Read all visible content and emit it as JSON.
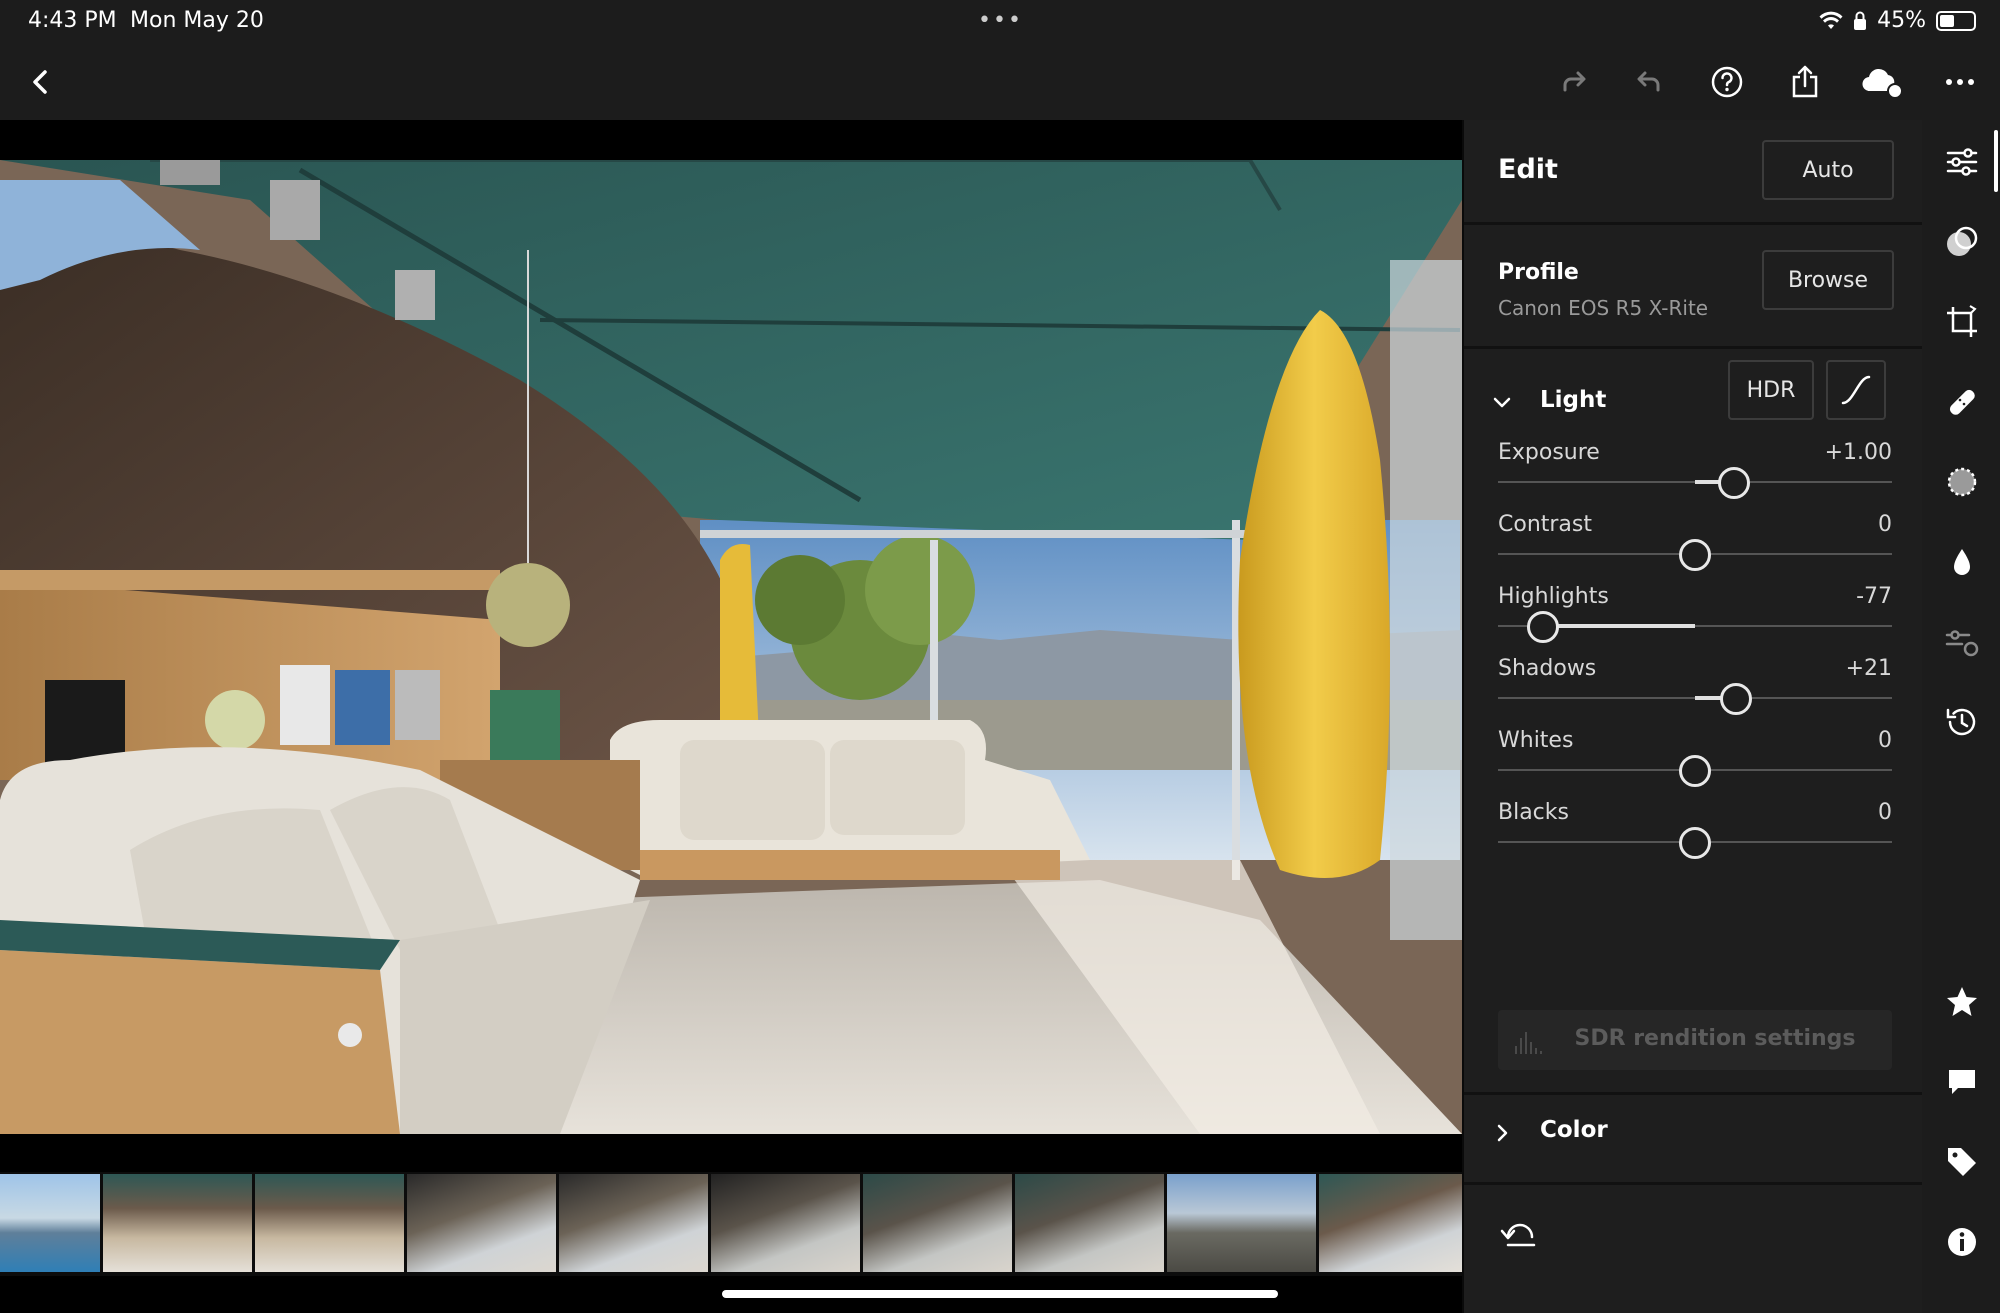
{
  "status_bar": {
    "time": "4:43 PM",
    "date": "Mon May 20",
    "dots": "•••",
    "battery": "45%"
  },
  "toolbar": {
    "icons": [
      "back-icon",
      "redo-icon",
      "undo-icon",
      "help-icon",
      "share-icon",
      "cloud-sync-icon",
      "more-icon"
    ]
  },
  "panel": {
    "title": "Edit",
    "auto_label": "Auto",
    "profile": {
      "label": "Profile",
      "value": "Canon EOS R5 X-Rite",
      "browse_label": "Browse"
    },
    "light": {
      "label": "Light",
      "hdr_label": "HDR",
      "sliders": [
        {
          "label": "Exposure",
          "value": "+1.00",
          "num": 1.0,
          "min": -5,
          "max": 5
        },
        {
          "label": "Contrast",
          "value": "0",
          "num": 0,
          "min": -100,
          "max": 100
        },
        {
          "label": "Highlights",
          "value": "-77",
          "num": -77,
          "min": -100,
          "max": 100
        },
        {
          "label": "Shadows",
          "value": "+21",
          "num": 21,
          "min": -100,
          "max": 100
        },
        {
          "label": "Whites",
          "value": "0",
          "num": 0,
          "min": -100,
          "max": 100
        },
        {
          "label": "Blacks",
          "value": "0",
          "num": 0,
          "min": -100,
          "max": 100
        }
      ],
      "sdr_label": "SDR rendition settings"
    },
    "color": {
      "label": "Color"
    }
  },
  "rail": {
    "icons": [
      "edit-sliders-icon",
      "presets-icon",
      "crop-icon",
      "healing-icon",
      "masking-icon",
      "blur-icon",
      "versions-icon",
      "history-icon",
      "star-icon",
      "comment-icon",
      "tag-icon",
      "info-icon"
    ]
  },
  "filmstrip": {
    "count": 10
  },
  "colors": {
    "panel_bg": "#1e1e1e",
    "bar_bg": "#1c1c1c",
    "accent": "#ffffff"
  }
}
